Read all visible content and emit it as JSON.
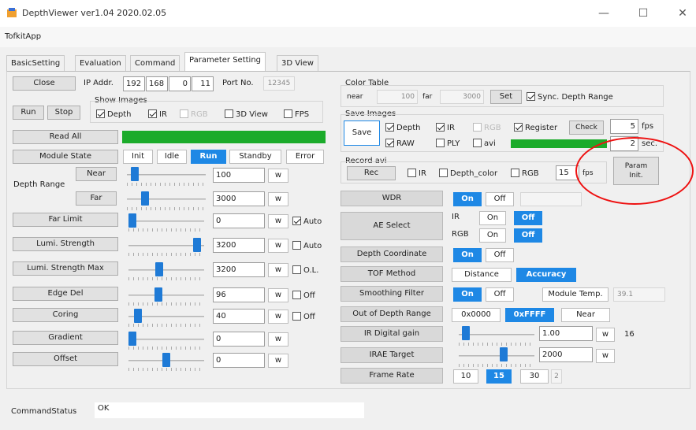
{
  "window": {
    "title": "DepthViewer ver1.04 2020.02.05",
    "min": "—",
    "max": "☐",
    "close": "✕"
  },
  "menu": {
    "app": "TofkitApp"
  },
  "tabs": [
    "BasicSetting",
    "Evaluation",
    "Command",
    "Parameter Setting",
    "3D View"
  ],
  "left": {
    "close": "Close",
    "ip_label": "IP Addr.",
    "ip": [
      "192",
      "168",
      "0",
      "11"
    ],
    "port_label": "Port No.",
    "port": "12345",
    "run": "Run",
    "stop": "Stop",
    "show_images": "Show Images",
    "show": {
      "depth": "Depth",
      "ir": "IR",
      "rgb": "RGB",
      "view3d": "3D View",
      "fps": "FPS"
    },
    "read_all": "Read All",
    "module_state": "Module State",
    "states": [
      "Init",
      "Idle",
      "Run",
      "Standby",
      "Error"
    ],
    "depth_range": "Depth Range",
    "near": "Near",
    "far": "Far",
    "w": "w",
    "auto": "Auto",
    "ol": "O.L.",
    "off": "Off",
    "params": [
      {
        "label": "Far Limit",
        "value": "0",
        "slider": 0.0
      },
      {
        "label": "Lumi. Strength",
        "value": "3200",
        "slider": 0.95
      },
      {
        "label": "Lumi. Strength Max",
        "value": "3200",
        "slider": 0.4
      },
      {
        "label": "Edge Del",
        "value": "96",
        "slider": 0.38
      },
      {
        "label": "Coring",
        "value": "40",
        "slider": 0.08
      },
      {
        "label": "Gradient",
        "value": "0",
        "slider": 0.0
      },
      {
        "label": "Offset",
        "value": "0",
        "slider": 0.5
      }
    ],
    "near_value": "100",
    "far_value": "3000",
    "near_slider": 0.05,
    "far_slider": 0.2
  },
  "right": {
    "color_table": "Color Table",
    "near": "near",
    "near_val": "100",
    "far": "far",
    "far_val": "3000",
    "set": "Set",
    "sync": "Sync. Depth Range",
    "save_images": "Save Images",
    "save": "Save",
    "depth": "Depth",
    "ir": "IR",
    "rgb": "RGB",
    "register": "Register",
    "check": "Check",
    "fps_val": "5",
    "fps": "fps",
    "raw": "RAW",
    "ply": "PLY",
    "avi": "avi",
    "sec_val": "2",
    "sec": "sec.",
    "record_avi": "Record avi",
    "rec": "Rec",
    "depth_color": "Depth_color",
    "rec_fps_val": "15",
    "param_init": "Param\nInit.",
    "wdr": "WDR",
    "on": "On",
    "off": "Off",
    "ae_select": "AE Select",
    "ir_label": "IR",
    "rgb_label": "RGB",
    "depth_coord": "Depth Coordinate",
    "tof_method": "TOF Method",
    "distance": "Distance",
    "accuracy": "Accuracy",
    "smoothing": "Smoothing Filter",
    "module_temp": "Module Temp.",
    "module_temp_val": "39.1",
    "out_of_depth": "Out of Depth Range",
    "hex0": "0x0000",
    "hexF": "0xFFFF",
    "near_btn": "Near",
    "ir_gain": "IR Digital gain",
    "ir_gain_val": "1.00",
    "w": "w",
    "ir_gain_max": "16",
    "ir_gain_slider": 0.05,
    "irae": "IRAE Target",
    "irae_val": "2000",
    "irae_slider": 0.6,
    "frame_rate": "Frame Rate",
    "fr": [
      "10",
      "15",
      "30"
    ],
    "fr_val": "2"
  },
  "status": {
    "label": "CommandStatus",
    "value": "OK"
  }
}
